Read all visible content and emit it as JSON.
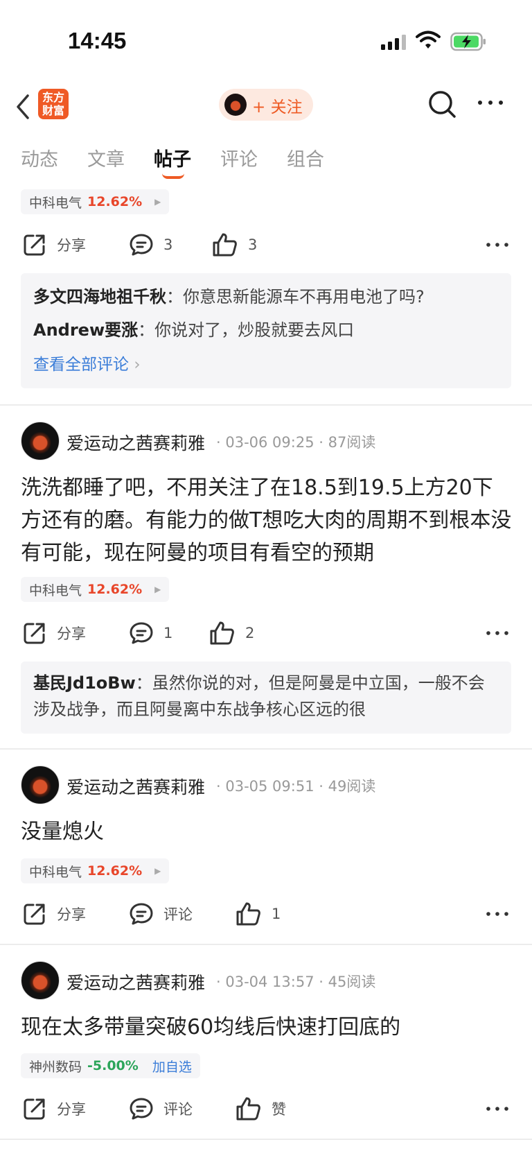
{
  "status_bar": {
    "time": "14:45"
  },
  "nav": {
    "logo_line1": "东方",
    "logo_line2": "财富",
    "follow_label": "+ 关注"
  },
  "tabs": [
    {
      "label": "动态"
    },
    {
      "label": "文章"
    },
    {
      "label": "帖子",
      "active": true
    },
    {
      "label": "评论"
    },
    {
      "label": "组合"
    }
  ],
  "colors": {
    "accent": "#ee5a24",
    "up": "#e8462a",
    "down": "#2ca55a",
    "link": "#3b7dd8"
  },
  "top_post": {
    "stock": {
      "name": "中科电气",
      "pct": "12.62%"
    },
    "share_label": "分享",
    "comment_count": "3",
    "like_count": "3",
    "comments": [
      {
        "author": "多文四海地祖千秋",
        "text": "你意思新能源车不再用电池了吗?"
      },
      {
        "author": "Andrew要涨",
        "text": "你说对了，炒股就要去风口"
      }
    ],
    "view_all": "查看全部评论"
  },
  "posts": [
    {
      "author": "爱运动之茜赛莉雅",
      "meta": "· 03-06 09:25 · 87阅读",
      "text": "洗洗都睡了吧，不用关注了在18.5到19.5上方20下方还有的磨。有能力的做T想吃大肉的周期不到根本没有可能，现在阿曼的项目有看空的预期",
      "stock": {
        "name": "中科电气",
        "pct": "12.62%"
      },
      "share_label": "分享",
      "comment_label": "1",
      "like_label": "2",
      "comments": [
        {
          "author": "基民Jd1oBw",
          "text": "虽然你说的对，但是阿曼是中立国，一般不会涉及战争，而且阿曼离中东战争核心区远的很"
        }
      ]
    },
    {
      "author": "爱运动之茜赛莉雅",
      "meta": "· 03-05 09:51 · 49阅读",
      "text": "没量熄火",
      "stock": {
        "name": "中科电气",
        "pct": "12.62%"
      },
      "share_label": "分享",
      "comment_label": "评论",
      "like_label": "1"
    },
    {
      "author": "爱运动之茜赛莉雅",
      "meta": "· 03-04 13:57 · 45阅读",
      "text": "现在太多带量突破60均线后快速打回底的",
      "stock": {
        "name": "神州数码",
        "pct": "-5.00%",
        "add": "加自选"
      },
      "share_label": "分享",
      "comment_label": "评论",
      "like_label": "赞"
    }
  ]
}
